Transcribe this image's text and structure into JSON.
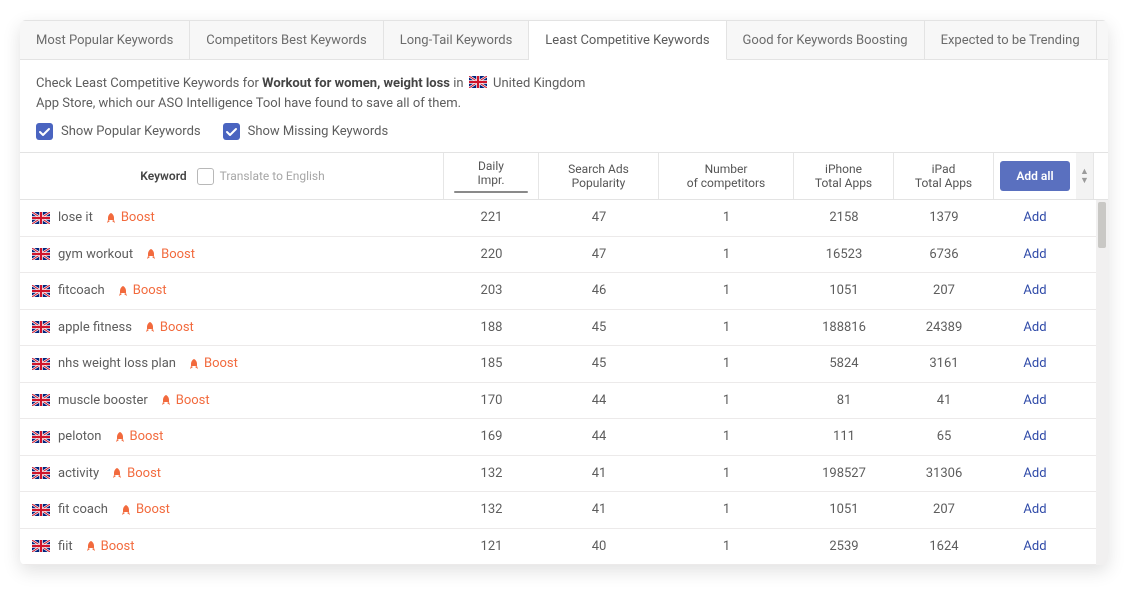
{
  "tabs": [
    {
      "label": "Most Popular Keywords",
      "active": false
    },
    {
      "label": "Competitors Best Keywords",
      "active": false
    },
    {
      "label": "Long-Tail Keywords",
      "active": false
    },
    {
      "label": "Least Competitive Keywords",
      "active": true
    },
    {
      "label": "Good for Keywords Boosting",
      "active": false
    },
    {
      "label": "Expected to be Trending",
      "active": false
    }
  ],
  "intro": {
    "prefix": "Check Least Competitive Keywords for ",
    "app_name": "Workout for women, weight loss",
    "mid": " in ",
    "country": " United Kingdom",
    "line2": "App Store, which our ASO Intelligence Tool have found to save all of them."
  },
  "checks": {
    "popular": {
      "label": "Show Popular Keywords",
      "checked": true
    },
    "missing": {
      "label": "Show Missing Keywords",
      "checked": true
    }
  },
  "headers": {
    "keyword": "Keyword",
    "translate": "Translate to English",
    "daily_l1": "Daily",
    "daily_l2": "Impr.",
    "pop_l1": "Search Ads",
    "pop_l2": "Popularity",
    "comp_l1": "Number",
    "comp_l2": "of competitors",
    "iphone_l1": "iPhone",
    "iphone_l2": "Total Apps",
    "ipad_l1": "iPad",
    "ipad_l2": "Total Apps",
    "add_all": "Add all"
  },
  "boost_label": "Boost",
  "add_label": "Add",
  "rows": [
    {
      "kw": "lose it",
      "daily": "221",
      "pop": "47",
      "comp": "1",
      "iphone": "2158",
      "ipad": "1379"
    },
    {
      "kw": "gym workout",
      "daily": "220",
      "pop": "47",
      "comp": "1",
      "iphone": "16523",
      "ipad": "6736"
    },
    {
      "kw": "fitcoach",
      "daily": "203",
      "pop": "46",
      "comp": "1",
      "iphone": "1051",
      "ipad": "207"
    },
    {
      "kw": "apple fitness",
      "daily": "188",
      "pop": "45",
      "comp": "1",
      "iphone": "188816",
      "ipad": "24389"
    },
    {
      "kw": "nhs weight loss plan",
      "daily": "185",
      "pop": "45",
      "comp": "1",
      "iphone": "5824",
      "ipad": "3161"
    },
    {
      "kw": "muscle booster",
      "daily": "170",
      "pop": "44",
      "comp": "1",
      "iphone": "81",
      "ipad": "41"
    },
    {
      "kw": "peloton",
      "daily": "169",
      "pop": "44",
      "comp": "1",
      "iphone": "111",
      "ipad": "65"
    },
    {
      "kw": "activity",
      "daily": "132",
      "pop": "41",
      "comp": "1",
      "iphone": "198527",
      "ipad": "31306"
    },
    {
      "kw": "fit coach",
      "daily": "132",
      "pop": "41",
      "comp": "1",
      "iphone": "1051",
      "ipad": "207"
    },
    {
      "kw": "fiit",
      "daily": "121",
      "pop": "40",
      "comp": "1",
      "iphone": "2539",
      "ipad": "1624"
    }
  ]
}
